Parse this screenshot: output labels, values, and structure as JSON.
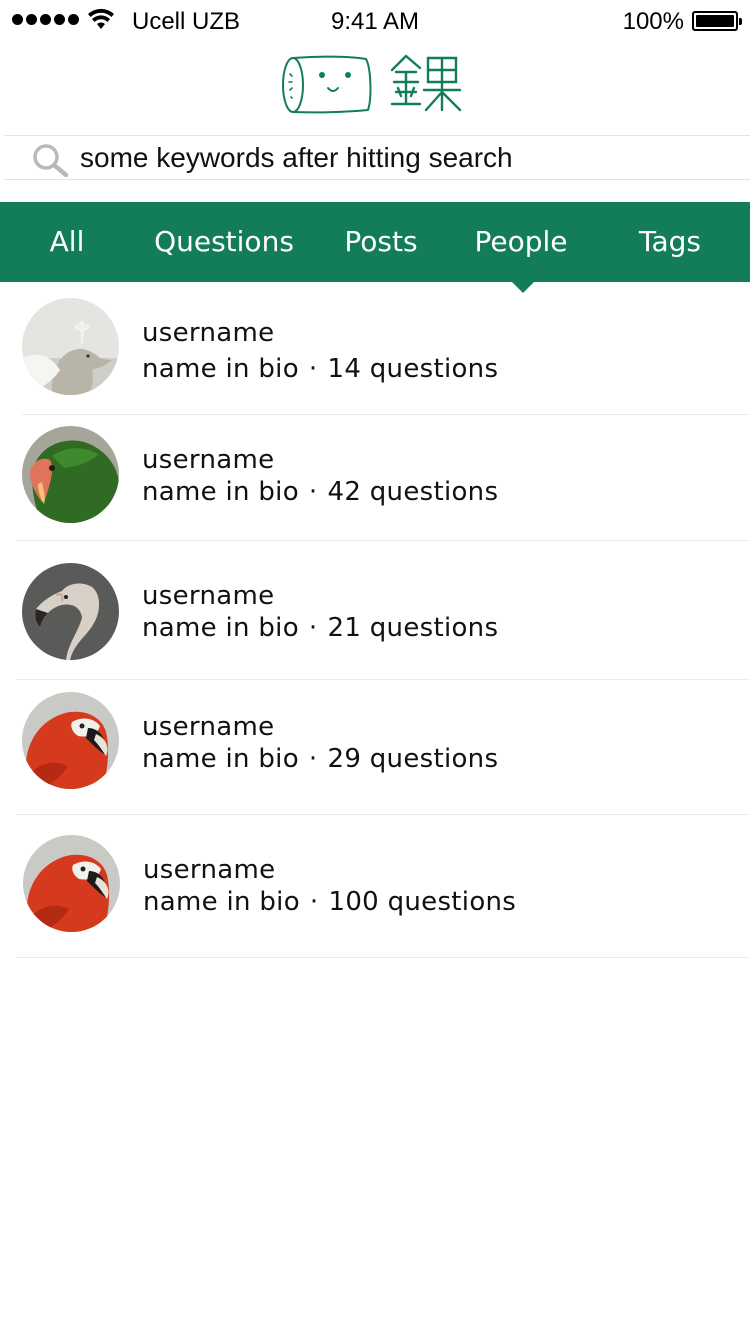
{
  "status_bar": {
    "carrier": "Ucell UZB",
    "time": "9:41 AM",
    "battery": "100%"
  },
  "logo": {
    "icon": "smiling-scroll-logo",
    "glyph": "錸",
    "color": "#137d5b"
  },
  "search": {
    "value": "some keywords after hitting search",
    "icon": "search-icon"
  },
  "tabs": [
    {
      "label": "All"
    },
    {
      "label": "Questions"
    },
    {
      "label": "Posts"
    },
    {
      "label": "People"
    },
    {
      "label": "Tags"
    }
  ],
  "active_tab": "People",
  "theme": {
    "accent": "#137d5b"
  },
  "people": [
    {
      "username": "username",
      "bio": "name in bio",
      "separator": "·",
      "questions": "14 questions",
      "avatar": "white-peacock-avatar"
    },
    {
      "username": "username",
      "bio": "name in bio",
      "separator": "·",
      "questions": "42 questions",
      "avatar": "green-parrot-avatar"
    },
    {
      "username": "username",
      "bio": "name in bio",
      "separator": "·",
      "questions": "21 questions",
      "avatar": "flamingo-avatar"
    },
    {
      "username": "username",
      "bio": "name in bio",
      "separator": "·",
      "questions": "29 questions",
      "avatar": "scarlet-macaw-avatar"
    },
    {
      "username": "username",
      "bio": "name in bio",
      "separator": "·",
      "questions": "100 questions",
      "avatar": "scarlet-macaw-avatar"
    }
  ]
}
